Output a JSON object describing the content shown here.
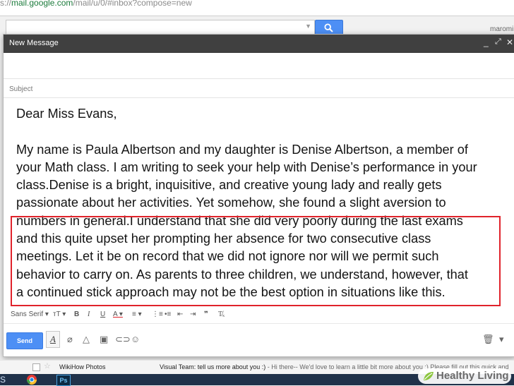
{
  "browser": {
    "url_scheme": "s://",
    "url_host": "mail.google.com",
    "url_path": "/mail/u/0/#inbox?compose=new"
  },
  "gmail_bg": {
    "user_partial": "maromi"
  },
  "compose": {
    "title": "New Message",
    "subject_placeholder": "Subject",
    "salutation": "Dear Miss Evans,",
    "body_lines": [
      "My name is Paula Albertson and my daughter is Denise Albertson, a member of",
      "your Math class.  I am writing to seek your help with Denise’s performance in your",
      "class.Denise is a bright, inquisitive, and creative young lady and really gets",
      "passionate about her activities.  Yet somehow, she found a slight aversion to",
      "numbers in general.I understand that she did very poorly during the last exams",
      "and this quite upset her prompting her absence for two consecutive class",
      "meetings.  Let it be on record that we did not ignore nor will we permit such",
      "behavior to carry on.  As parents to three children, we understand, however, that",
      "a continued stick approach may not be the best option in situations like this."
    ],
    "highlight_color": "#e0232b",
    "format_font": "Sans Serif",
    "send_label": "Send"
  },
  "inbox_row": {
    "sender": "WikiHow Photos",
    "subject": "Visual Team: tell us more about you :)",
    "snippet": " - Hi there-- We'd love to learn a little bit more about you :) Please fill out this quick and"
  },
  "watermark": {
    "text": "Healthy Living",
    "color": "#8cc63f"
  },
  "colors": {
    "send": "#4d8ff5",
    "titlebar": "#404040"
  }
}
